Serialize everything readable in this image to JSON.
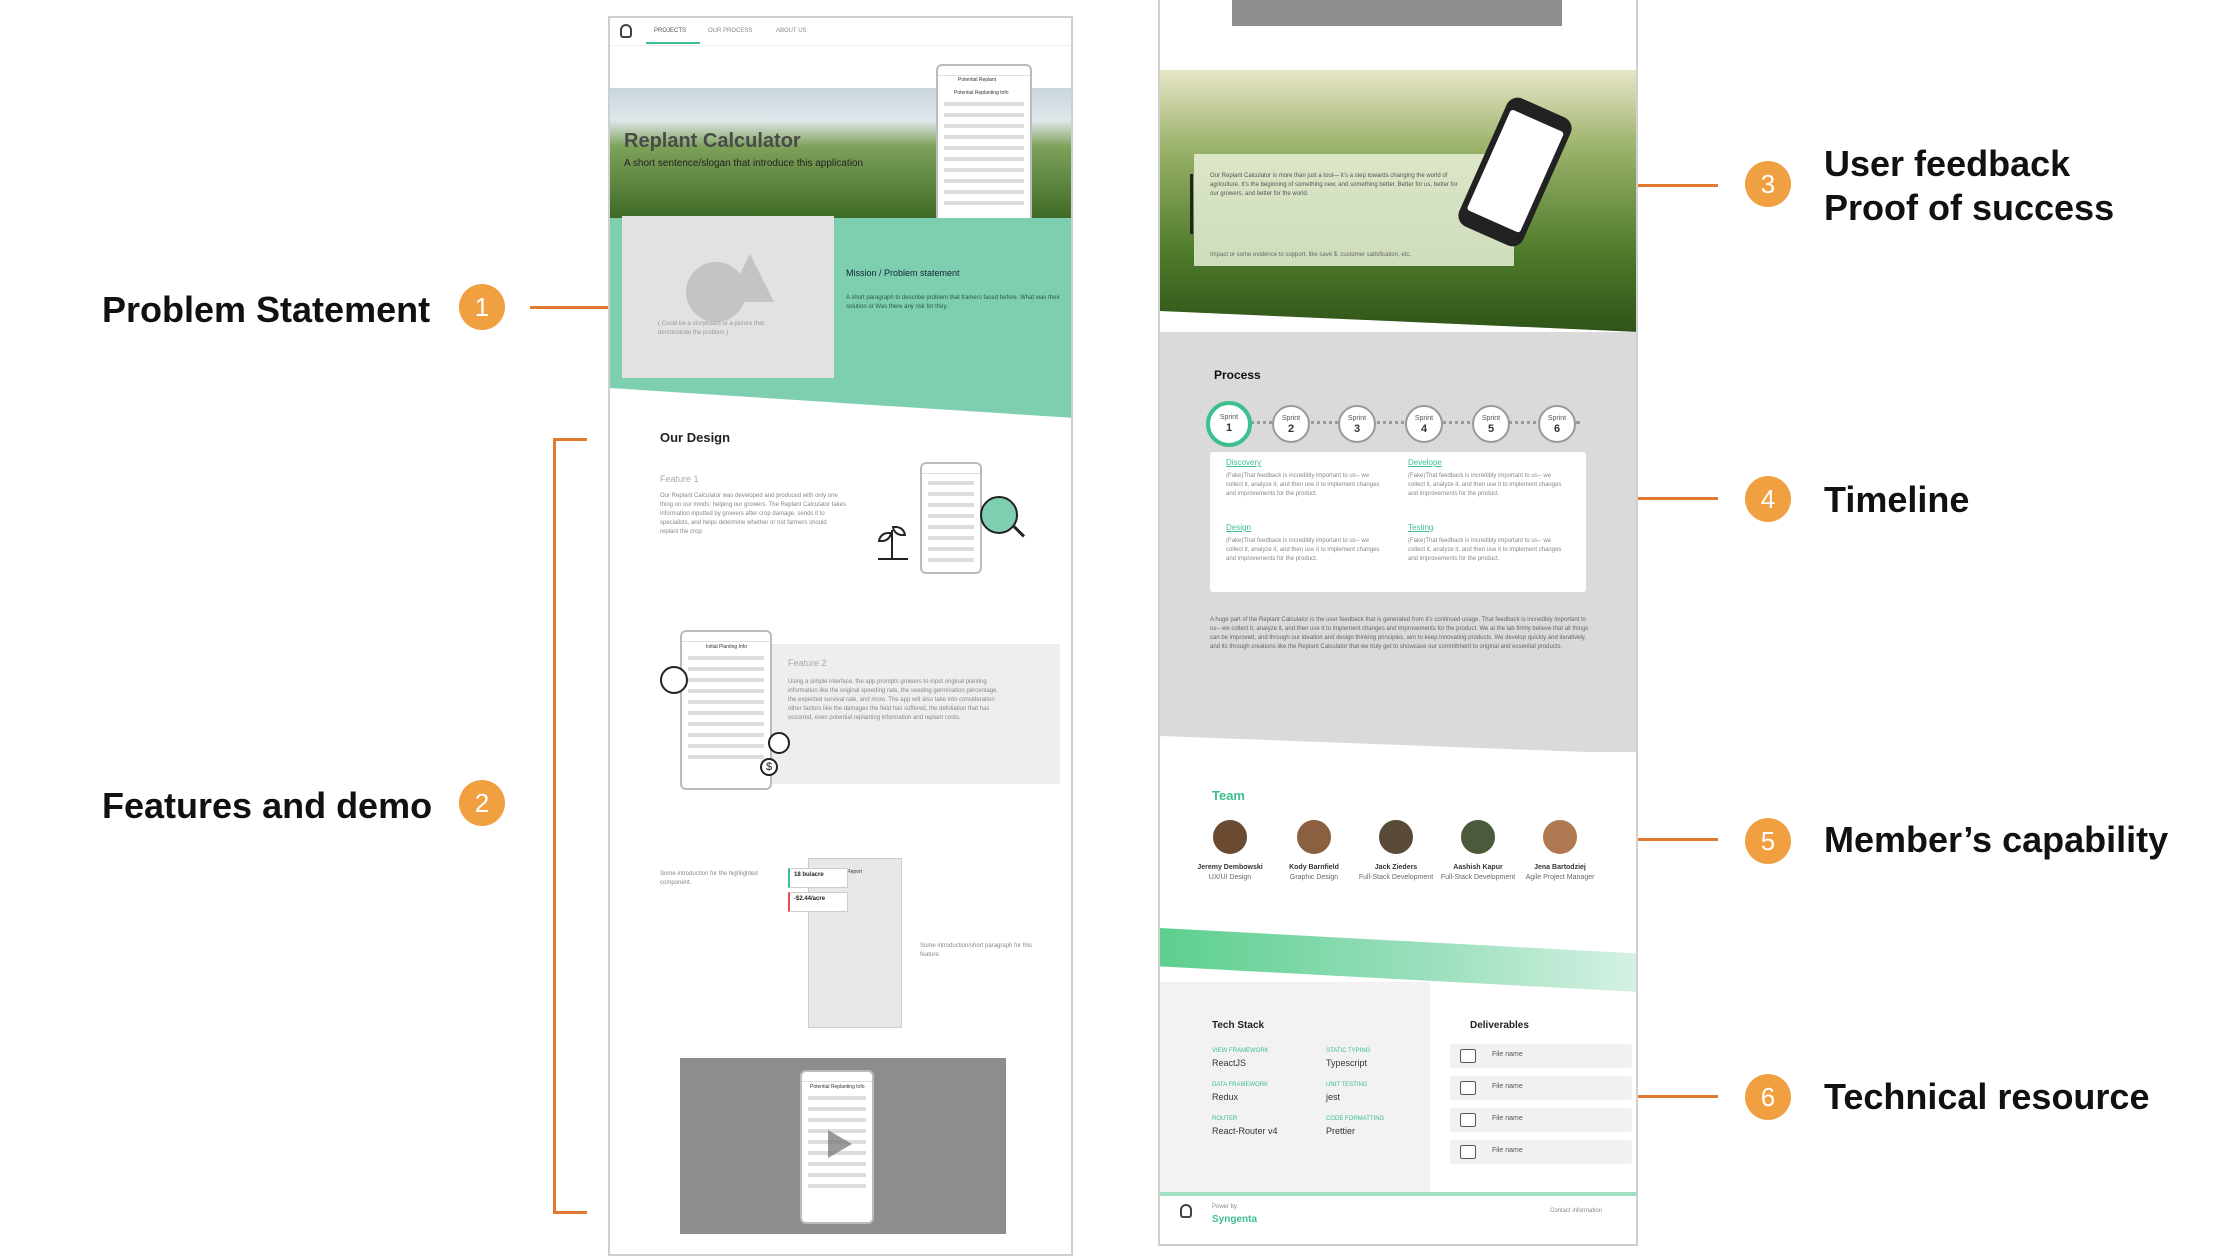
{
  "callouts": {
    "problem_statement": {
      "num": "1",
      "label": "Problem Statement"
    },
    "features_demo": {
      "num": "2",
      "label": "Features and demo"
    },
    "feedback": {
      "num": "3",
      "label_1": "User feedback",
      "label_2": "Proof of success"
    },
    "timeline": {
      "num": "4",
      "label": "Timeline"
    },
    "members": {
      "num": "5",
      "label": "Member’s capability"
    },
    "technical": {
      "num": "6",
      "label": "Technical resource"
    }
  },
  "left_page": {
    "nav": {
      "projects": "PROJECTS",
      "process": "OUR PROCESS",
      "about": "ABOUT US"
    },
    "hero": {
      "title": "Replant Calculator",
      "subtitle": "A short sentence/slogan that introduce this application"
    },
    "hero_phone": {
      "header": "Potential Replant",
      "title": "Potential Replanting Info"
    },
    "mission": {
      "heading": "Mission / Problem statement",
      "body": "A short paragraph to describe problem that framers faced before. What was their solution or Was there any risk for they.",
      "image_caption": "( Could be a storyboard or a picture that demonstrate the problem )"
    },
    "design": {
      "heading": "Our Design"
    },
    "feature1": {
      "title": "Feature 1",
      "body": "Our Replant Calculator was developed and produced with only one thing on our minds: helping our growers. The Replant Calculator takes information inputted by growers after crop damage, sends it to specialists, and helps determine whether or not farmers should replant the crop."
    },
    "feature2": {
      "title": "Feature 2",
      "body": "Using a simple interface, the app prompts growers to input original planting information like the original speeding rate, the seeding germination percentage, the expected survival rate, and more. The app will also take into consideration other factors like the damages the field has suffered, the defoliation that has occurred, even potential replanting information and replant costs.",
      "phone_title": "Initial Planting Info"
    },
    "feature3": {
      "intro": "Some introduction for the highlighted component.",
      "outro": "Some introduction/short paragraph for this feature.",
      "card1": "18 bu/acre",
      "card2": "-$2.44/acre",
      "phone_title": "Report"
    },
    "video_phone": {
      "title": "Potential Replanting Info"
    }
  },
  "right_page": {
    "feedback": {
      "text": "Our Replant Calculator is more than just a tool— it’s a step towards changing the world of agriculture. It’s the beginning of something new, and something better. Better for us, better for our growers, and better for the world.",
      "impact": "Impact or some evidence to support. like save $, customer satisfication, etc."
    },
    "process": {
      "heading": "Process",
      "sprint_label": "Sprint",
      "sprints": [
        "1",
        "2",
        "3",
        "4",
        "5",
        "6"
      ],
      "phases": [
        {
          "name": "Discovery",
          "text": "(Fake)That feedback is incredibly important to us-- we collect it, analyze it, and then use it to implement changes and improvements for the product."
        },
        {
          "name": "Develope",
          "text": "(Fake)That feedback is incredibly important to us-- we collect it, analyze it, and then use it to implement changes and improvements for the product."
        },
        {
          "name": "Design",
          "text": "(Fake)That feedback is incredibly important to us-- we collect it, analyze it, and then use it to implement changes and improvements for the product."
        },
        {
          "name": "Testing",
          "text": "(Fake)That feedback is incredibly important to us-- we collect it, analyze it, and then use it to implement changes and improvements for the product."
        }
      ],
      "summary": "A huge part of the Replant Calculator is the user feedback that is generated from it’s continued usage. That feedback is incredibly important to us-- we collect it, analyze it, and then use it to implement changes and improvements for the product. We at the lab firmly believe that all things can be improved, and through our ideation and design thinking principles, aim to keep innovating products. We develop quickly and iteratively, and its through creations like the Replant Calculator that we truly get to showcase our commitment to original and essential products."
    },
    "team": {
      "heading": "Team",
      "members": [
        {
          "name": "Jeremy Dembowski",
          "role": "UX/UI Design"
        },
        {
          "name": "Kody Barnfield",
          "role": "Graphic Design"
        },
        {
          "name": "Jack Zieders",
          "role": "Full-Stack Development"
        },
        {
          "name": "Aashish Kapur",
          "role": "Full-Stack Development"
        },
        {
          "name": "Jena Bartodziej",
          "role": "Agile Project Manager"
        }
      ]
    },
    "tech": {
      "heading": "Tech Stack",
      "items": [
        {
          "k": "VIEW FRAMEWORK",
          "v": "ReactJS"
        },
        {
          "k": "STATIC TYPING",
          "v": "Typescript"
        },
        {
          "k": "DATA FRAMEWORK",
          "v": "Redux"
        },
        {
          "k": "UNIT TESTING",
          "v": "jest"
        },
        {
          "k": "ROUTER",
          "v": "React-Router v4"
        },
        {
          "k": "CODE FORMATTING",
          "v": "Prettier"
        }
      ]
    },
    "deliverables": {
      "heading": "Deliverables",
      "files": [
        "File name",
        "File name",
        "File name",
        "File name"
      ]
    },
    "footer": {
      "power": "Power by",
      "brand": "Syngenta",
      "contact": "Contact information"
    }
  },
  "colors": {
    "accent_orange": "#f0a040",
    "line_orange": "#e07a2e",
    "mint": "#7ecfb0",
    "green": "#3dbf8e"
  }
}
